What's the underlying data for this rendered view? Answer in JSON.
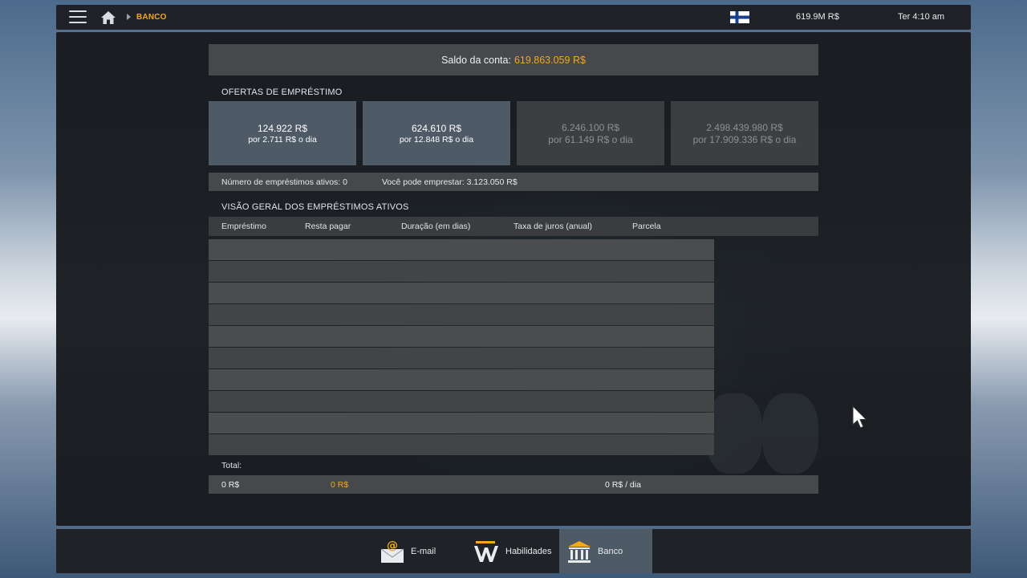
{
  "topbar": {
    "breadcrumb": "BANCO",
    "money": "619.9M  R$",
    "time": "Ter 4:10 am",
    "flag": "finland-flag"
  },
  "balance": {
    "label": "Saldo da conta:",
    "value": "619.863.059 R$"
  },
  "offers": {
    "title": "OFERTAS DE EMPRÉSTIMO",
    "items": [
      {
        "amount": "124.922 R$",
        "rate": "por 2.711 R$ o dia",
        "state": "active"
      },
      {
        "amount": "624.610 R$",
        "rate": "por 12.848 R$ o dia",
        "state": "active"
      },
      {
        "amount": "6.246.100 R$",
        "rate": "por 61.149 R$ o dia",
        "state": "disabled"
      },
      {
        "amount": "2.498.439.980 R$",
        "rate": "por 17.909.336 R$ o dia",
        "state": "disabled"
      }
    ]
  },
  "info": {
    "active_loans": "Número de empréstimos ativos: 0",
    "can_borrow": "Você pode emprestar: 3.123.050 R$"
  },
  "overview": {
    "title": "VISÃO GERAL DOS EMPRÉSTIMOS ATIVOS",
    "columns": [
      "Empréstimo",
      "Resta pagar",
      "Duração (em dias)",
      "Taxa de juros (anual)",
      "Parcela"
    ],
    "rows": []
  },
  "total": {
    "label": "Total:",
    "loan": "0 R$",
    "remaining": "0 R$",
    "installment": "0 R$ / dia"
  },
  "bottom_nav": [
    {
      "label": "E-mail",
      "icon": "email-icon"
    },
    {
      "label": "Habilidades",
      "icon": "skills-icon"
    },
    {
      "label": "Banco",
      "icon": "bank-icon",
      "active": true
    }
  ],
  "colors": {
    "accent": "#f4a81c",
    "active_tile": "#4e5b67",
    "panel": "#181b1f"
  }
}
